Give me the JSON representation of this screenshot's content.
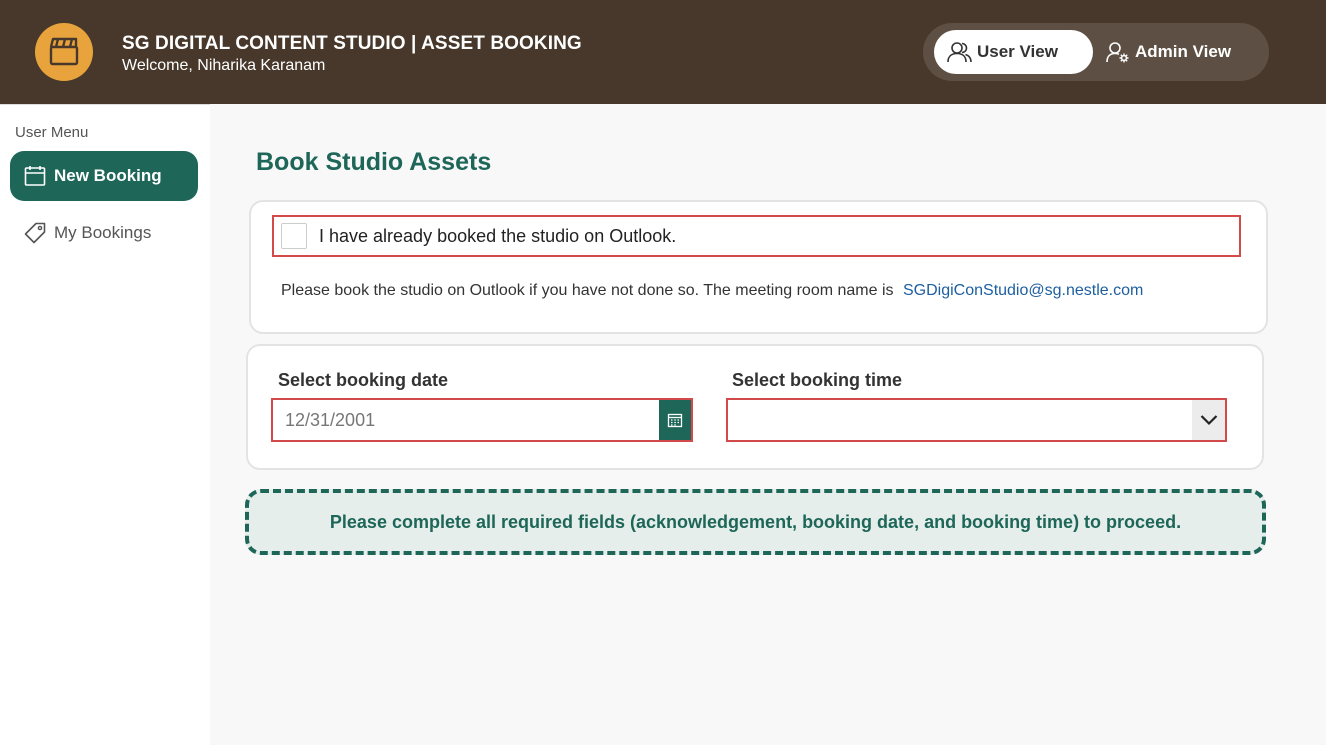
{
  "header": {
    "logo_icon": "clapperboard-icon",
    "title": "SG DIGITAL CONTENT STUDIO | ASSET BOOKING",
    "welcome": "Welcome, Niharika Karanam",
    "colors": {
      "background": "#47382b",
      "logo": "#e8a33d"
    }
  },
  "view_toggle": {
    "user_view": {
      "label": "User View",
      "icon": "users-icon",
      "selected": true
    },
    "admin_view": {
      "label": "Admin View",
      "icon": "user-gear-icon",
      "selected": false
    }
  },
  "sidebar": {
    "heading": "User Menu",
    "items": [
      {
        "label": "New Booking",
        "icon": "calendar-icon",
        "active": true
      },
      {
        "label": "My Bookings",
        "icon": "tag-icon",
        "active": false
      }
    ]
  },
  "main": {
    "title": "Book Studio Assets",
    "acknowledgement": {
      "label": "I have already booked the studio on Outlook.",
      "checked": false
    },
    "hint": {
      "text": "Please book the studio on Outlook if you have not done so. The meeting room name is",
      "email": "SGDigiConStudio@sg.nestle.com"
    },
    "date_field": {
      "label": "Select booking date",
      "placeholder": "12/31/2001",
      "value": ""
    },
    "time_field": {
      "label": "Select booking time",
      "value": ""
    },
    "notice": "Please complete all required fields (acknowledgement, booking date, and booking time) to proceed."
  },
  "colors": {
    "accent": "#1d6658",
    "error_border": "#d24a4a",
    "notice_bg": "#e5eeeb",
    "link": "#1d5fa0"
  }
}
